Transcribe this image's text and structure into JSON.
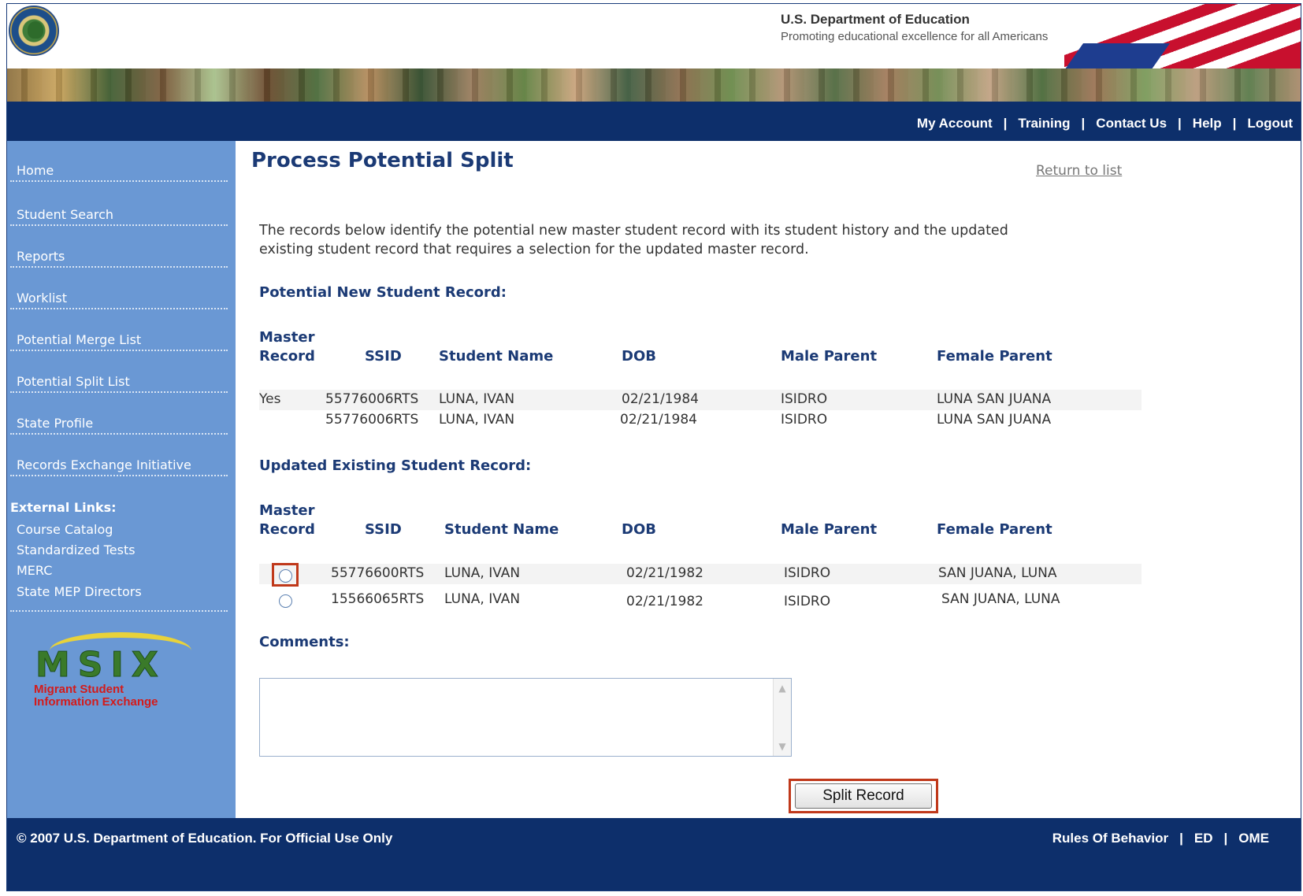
{
  "header": {
    "dept_name": "U.S. Department of Education",
    "tagline": "Promoting educational excellence for all Americans",
    "nav": [
      "My Account",
      "Training",
      "Contact Us",
      "Help",
      "Logout"
    ]
  },
  "sidebar": {
    "items": [
      "Home",
      "Student Search",
      "Reports",
      "Worklist",
      "Potential Merge List",
      "Potential Split List",
      "State Profile",
      "Records Exchange Initiative"
    ],
    "external_title": "External Links:",
    "external_links": [
      "Course Catalog",
      "Standardized Tests",
      "MERC",
      "State MEP Directors"
    ],
    "logo": {
      "letters": "MSIX",
      "line1": "Migrant Student",
      "line2": "Information Exchange"
    }
  },
  "main": {
    "title": "Process Potential Split",
    "return_link": "Return to list",
    "intro_line1": "The records below identify the potential new master student record with its student history and the updated",
    "intro_line2": "existing student record that requires a selection for the updated master record.",
    "new_section": {
      "heading": "Potential New Student Record:",
      "columns": {
        "master1": "Master",
        "master2": "Record",
        "ssid": "SSID",
        "name": "Student Name",
        "dob": "DOB",
        "male": "Male Parent",
        "female": "Female Parent"
      },
      "rows": [
        {
          "master": "Yes",
          "ssid": "55776006RTS",
          "name": "LUNA, IVAN",
          "dob": "02/21/1984",
          "male": "ISIDRO",
          "female": "LUNA SAN JUANA"
        },
        {
          "master": "",
          "ssid": "55776006RTS",
          "name": "LUNA, IVAN",
          "dob": "02/21/1984",
          "male": "ISIDRO",
          "female": "LUNA SAN JUANA"
        }
      ]
    },
    "existing_section": {
      "heading": "Updated Existing Student Record:",
      "columns": {
        "master1": "Master",
        "master2": "Record",
        "ssid": "SSID",
        "name": "Student Name",
        "dob": "DOB",
        "male": "Male Parent",
        "female": "Female Parent"
      },
      "rows": [
        {
          "ssid": "55776600RTS",
          "name": "LUNA, IVAN",
          "dob": "02/21/1982",
          "male": "ISIDRO",
          "female": "SAN JUANA, LUNA"
        },
        {
          "ssid": "15566065RTS",
          "name": "LUNA, IVAN",
          "dob": "02/21/1982",
          "male": "ISIDRO",
          "female": "SAN JUANA, LUNA"
        }
      ]
    },
    "comments_label": "Comments:",
    "comments_value": "",
    "split_button": "Split Record"
  },
  "footer": {
    "copyright": "© 2007 U.S. Department of Education. For Official Use Only",
    "links": [
      "Rules Of Behavior",
      "ED",
      "OME"
    ]
  },
  "colors": {
    "nav_bg": "#0d2f6b",
    "sidebar_bg": "#6a98d4",
    "heading": "#1b3a75",
    "highlight": "#c0391b"
  }
}
